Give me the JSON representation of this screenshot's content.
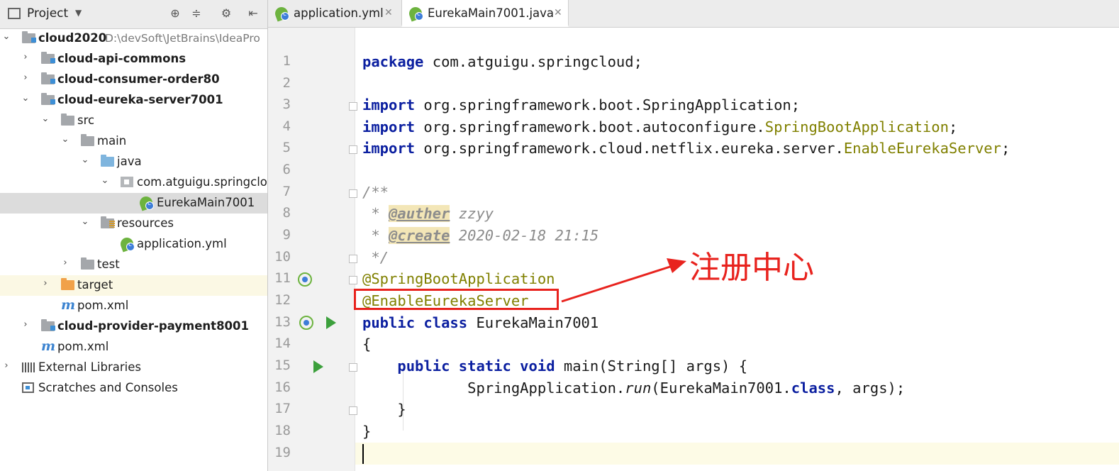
{
  "project_panel": {
    "title": "Project",
    "tree": [
      {
        "label": "cloud2020",
        "path": "D:\\devSoft\\JetBrains\\IdeaPro"
      },
      {
        "label": "cloud-api-commons"
      },
      {
        "label": "cloud-consumer-order80"
      },
      {
        "label": "cloud-eureka-server7001"
      },
      {
        "label": "src"
      },
      {
        "label": "main"
      },
      {
        "label": "java"
      },
      {
        "label": "com.atguigu.springclo"
      },
      {
        "label": "EurekaMain7001"
      },
      {
        "label": "resources"
      },
      {
        "label": "application.yml"
      },
      {
        "label": "test"
      },
      {
        "label": "target"
      },
      {
        "label": "pom.xml"
      },
      {
        "label": "cloud-provider-payment8001"
      },
      {
        "label": "pom.xml"
      },
      {
        "label": "External Libraries"
      },
      {
        "label": "Scratches and Consoles"
      }
    ]
  },
  "tabs": [
    {
      "label": "application.yml"
    },
    {
      "label": "EurekaMain7001.java"
    }
  ],
  "editor": {
    "line_numbers": [
      "1",
      "2",
      "3",
      "4",
      "5",
      "6",
      "7",
      "8",
      "9",
      "10",
      "11",
      "12",
      "13",
      "14",
      "15",
      "16",
      "17",
      "18",
      "19"
    ],
    "code": {
      "l1_kw": "package",
      "l1_rest": " com.atguigu.springcloud;",
      "l3_kw": "import",
      "l3_rest": " org.springframework.boot.SpringApplication;",
      "l4_kw": "import",
      "l4_rest": " org.springframework.boot.autoconfigure.",
      "l4_ann": "SpringBootApplication",
      "l4_end": ";",
      "l5_kw": "import",
      "l5_rest": " org.springframework.cloud.netflix.eureka.server.",
      "l5_ann": "EnableEurekaServer",
      "l5_end": ";",
      "l7": "/**",
      "l8_pre": " * ",
      "l8_tag": "@auther",
      "l8_val": " zzyy",
      "l9_pre": " * ",
      "l9_tag": "@create",
      "l9_val": " 2020-02-18 21:15",
      "l10": " */",
      "l11": "@SpringBootApplication",
      "l12": "@EnableEurekaServer",
      "l13_kw": "public class",
      "l13_rest": " EurekaMain7001",
      "l14": "{",
      "l15_indent": "    ",
      "l15_kw": "public static void",
      "l15_rest": " main(String[] args) {",
      "l16_pre": "            SpringApplication.",
      "l16_it": "run",
      "l16_mid": "(EurekaMain7001.",
      "l16_kw": "class",
      "l16_end": ", args);",
      "l17": "    }",
      "l18": "}"
    }
  },
  "annotation": {
    "callout_text": "注册中心",
    "color": "#e8231e"
  }
}
